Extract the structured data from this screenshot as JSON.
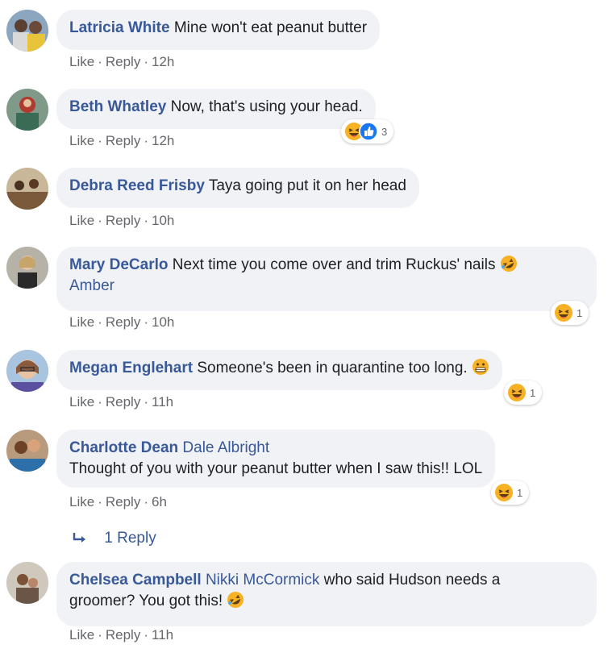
{
  "comments": [
    {
      "author": "Latricia White",
      "tags": "",
      "text": "Mine won't eat peanut butter",
      "like": "Like",
      "reply": "Reply",
      "time": "12h",
      "reaction_count": ""
    },
    {
      "author": "Beth Whatley",
      "tags": "",
      "text": "Now, that's using your head.",
      "like": "Like",
      "reply": "Reply",
      "time": "12h",
      "reaction_count": "3"
    },
    {
      "author": "Debra Reed Frisby",
      "tags": "",
      "text": "Taya going put it on her head",
      "like": "Like",
      "reply": "Reply",
      "time": "10h",
      "reaction_count": ""
    },
    {
      "author": "Mary DeCarlo",
      "tags": "Amber",
      "text": "Next time you come over and trim Ruckus' nails",
      "like": "Like",
      "reply": "Reply",
      "time": "10h",
      "reaction_count": "1"
    },
    {
      "author": "Megan Englehart",
      "tags": "",
      "text": "Someone's been in quarantine too long.",
      "like": "Like",
      "reply": "Reply",
      "time": "11h",
      "reaction_count": "1"
    },
    {
      "author": "Charlotte Dean",
      "tags": "Dale Albright",
      "text": "Thought of you with your peanut butter when I saw this!! LOL",
      "like": "Like",
      "reply": "Reply",
      "time": "6h",
      "reaction_count": "1",
      "replies_label": "1 Reply"
    },
    {
      "author": "Chelsea Campbell",
      "tags": "Nikki McCormick",
      "text": "who said Hudson needs a",
      "text2": "groomer? You got this!",
      "like": "Like",
      "reply": "Reply",
      "time": "11h",
      "reaction_count": ""
    }
  ],
  "separator": "·",
  "colors": {
    "link": "#385898",
    "bubble": "#f0f2f5",
    "meta": "#65676b",
    "haha": "#f7b125",
    "like_blue": "#1877f2"
  },
  "icons": {
    "haha": "laughing-face-icon",
    "rofl": "rolling-laughing-icon",
    "grimace": "grimacing-face-icon",
    "like": "thumbs-up-icon",
    "reply_arrow": "reply-arrow-icon"
  }
}
